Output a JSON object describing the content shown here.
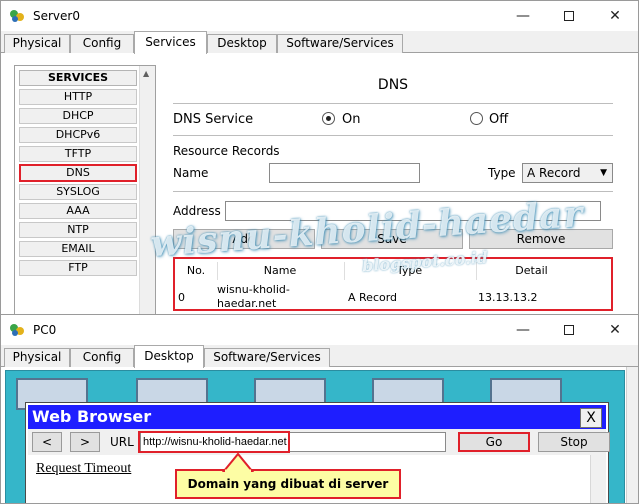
{
  "server_window": {
    "title": "Server0",
    "tabs": [
      {
        "label": "Physical"
      },
      {
        "label": "Config"
      },
      {
        "label": "Services"
      },
      {
        "label": "Desktop"
      },
      {
        "label": "Software/Services"
      }
    ],
    "active_tab": "Services",
    "services_panel": {
      "title": "SERVICES",
      "items": [
        "HTTP",
        "DHCP",
        "DHCPv6",
        "TFTP",
        "DNS",
        "SYSLOG",
        "AAA",
        "NTP",
        "EMAIL",
        "FTP"
      ],
      "selected": "DNS"
    },
    "dns": {
      "heading": "DNS",
      "service_label": "DNS Service",
      "on_label": "On",
      "off_label": "Off",
      "service_state": "On",
      "resource_records_label": "Resource Records",
      "name_label": "Name",
      "name_value": "",
      "type_label": "Type",
      "type_value": "A Record",
      "address_label": "Address",
      "address_value": "",
      "add_label": "Add",
      "save_label": "Save",
      "remove_label": "Remove",
      "table": {
        "headers": [
          "No.",
          "Name",
          "Type",
          "Detail"
        ],
        "rows": [
          {
            "no": "0",
            "name_line1": "wisnu-kholid-",
            "name_line2": "haedar.net",
            "type": "A Record",
            "detail": "13.13.13.2"
          }
        ]
      }
    }
  },
  "pc_window": {
    "title": "PC0",
    "tabs": [
      {
        "label": "Physical"
      },
      {
        "label": "Config"
      },
      {
        "label": "Desktop"
      },
      {
        "label": "Software/Services"
      }
    ],
    "active_tab": "Desktop",
    "browser": {
      "title": "Web Browser",
      "close_label": "X",
      "back_label": "<",
      "forward_label": ">",
      "url_label": "URL",
      "url_value": "http://wisnu-kholid-haedar.net",
      "go_label": "Go",
      "stop_label": "Stop",
      "page_text": "Request Timeout"
    }
  },
  "annotations": {
    "watermark": "wisnu-kholid-haedar",
    "watermark_sub": "blogspot.co.id",
    "callout": "Domain yang dibuat di server"
  },
  "colors": {
    "highlight_red": "#e0202a",
    "browser_title_blue": "#1e1eff",
    "desktop_teal": "#35b6c9",
    "callout_yellow": "#fdfda4"
  }
}
